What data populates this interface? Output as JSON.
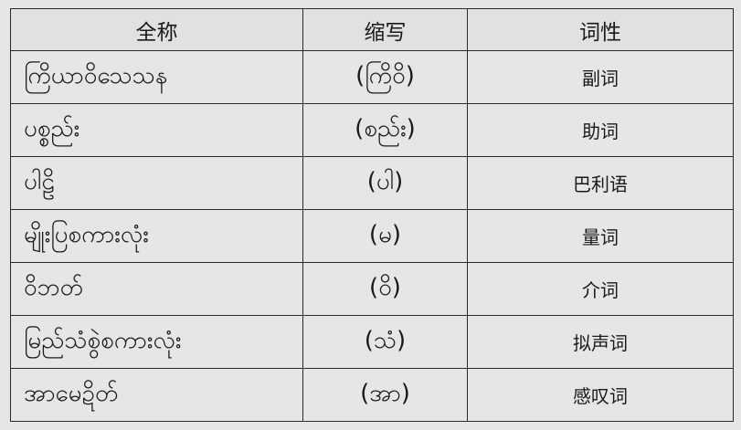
{
  "table": {
    "headers": {
      "full_name": "全称",
      "abbreviation": "缩写",
      "part_of_speech": "词性"
    },
    "rows": [
      {
        "full_name": "ကြိယာဝိသေသန",
        "abbreviation": "(ကြိဝိ)",
        "part_of_speech": "副词"
      },
      {
        "full_name": "ပစ္စည်း",
        "abbreviation": "(စည်း)",
        "part_of_speech": "助词"
      },
      {
        "full_name": "ပါဠိ",
        "abbreviation": "(ပါ)",
        "part_of_speech": "巴利语"
      },
      {
        "full_name": "မျိုးပြစကားလုံး",
        "abbreviation": "(မ)",
        "part_of_speech": "量词"
      },
      {
        "full_name": "ဝိဘတ်",
        "abbreviation": "(ဝိ)",
        "part_of_speech": "介词"
      },
      {
        "full_name": "မြည်သံစွဲစကားလုံး",
        "abbreviation": "(သံ)",
        "part_of_speech": "拟声词"
      },
      {
        "full_name": "အာမေဍိတ်",
        "abbreviation": "(အာ)",
        "part_of_speech": "感叹词"
      }
    ]
  }
}
